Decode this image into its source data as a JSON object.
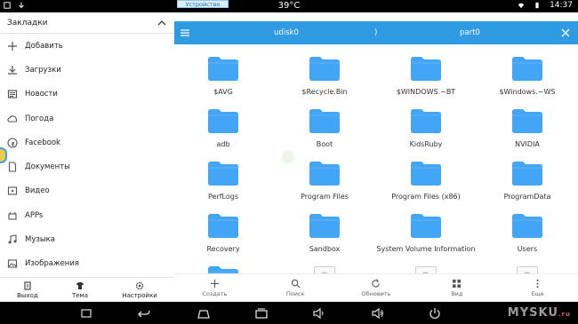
{
  "status_bar": {
    "temperature": "39°C",
    "time": "14:37"
  },
  "left_panel": {
    "header_title": "Закладки",
    "items": [
      {
        "label": "Добавить",
        "icon": "plus-icon"
      },
      {
        "label": "Загрузки",
        "icon": "download-icon"
      },
      {
        "label": "Новости",
        "icon": "news-icon"
      },
      {
        "label": "Погода",
        "icon": "cloud-icon"
      },
      {
        "label": "Facebook",
        "icon": "facebook-icon"
      },
      {
        "label": "Документы",
        "icon": "document-icon"
      },
      {
        "label": "Видео",
        "icon": "video-icon"
      },
      {
        "label": "APPs",
        "icon": "apps-icon"
      },
      {
        "label": "Музыка",
        "icon": "music-icon"
      },
      {
        "label": "Изображения",
        "icon": "image-icon"
      }
    ],
    "bottom": [
      {
        "label": "Выход",
        "icon": "exit-icon"
      },
      {
        "label": "Тема",
        "icon": "theme-icon"
      },
      {
        "label": "Настройки",
        "icon": "settings-icon"
      }
    ]
  },
  "right_panel": {
    "window_tag": "Устройство",
    "breadcrumb": [
      "udisk0",
      ")",
      "part0"
    ],
    "files": [
      {
        "name": "$AVG",
        "type": "folder"
      },
      {
        "name": "$Recycle.Bin",
        "type": "folder"
      },
      {
        "name": "$WINDOWS.~BT",
        "type": "folder"
      },
      {
        "name": "$Windows.~WS",
        "type": "folder"
      },
      {
        "name": "adb",
        "type": "folder"
      },
      {
        "name": "Boot",
        "type": "folder"
      },
      {
        "name": "KidsRuby",
        "type": "folder"
      },
      {
        "name": "NVIDIA",
        "type": "folder"
      },
      {
        "name": "PerfLogs",
        "type": "folder"
      },
      {
        "name": "Program Files",
        "type": "folder"
      },
      {
        "name": "Program Files (x86)",
        "type": "folder"
      },
      {
        "name": "ProgramData",
        "type": "folder"
      },
      {
        "name": "Recovery",
        "type": "folder"
      },
      {
        "name": "Sandbox",
        "type": "folder"
      },
      {
        "name": "System Volume Information",
        "type": "folder"
      },
      {
        "name": "Users",
        "type": "folder"
      },
      {
        "name": "",
        "type": "folder"
      },
      {
        "name": "",
        "type": "unknown"
      },
      {
        "name": "",
        "type": "unknown"
      },
      {
        "name": "",
        "type": "unknown"
      }
    ],
    "bottom": [
      {
        "label": "Создать",
        "icon": "plus-icon"
      },
      {
        "label": "Поиск",
        "icon": "search-icon"
      },
      {
        "label": "Обновить",
        "icon": "refresh-icon"
      },
      {
        "label": "Вид",
        "icon": "grid-view-icon"
      },
      {
        "label": "Еще",
        "icon": "more-icon"
      }
    ]
  },
  "watermark": {
    "text": "MYSKU",
    "suffix": ".ru"
  },
  "colors": {
    "accent": "#2f9be3",
    "folder": "#42a5f5"
  }
}
